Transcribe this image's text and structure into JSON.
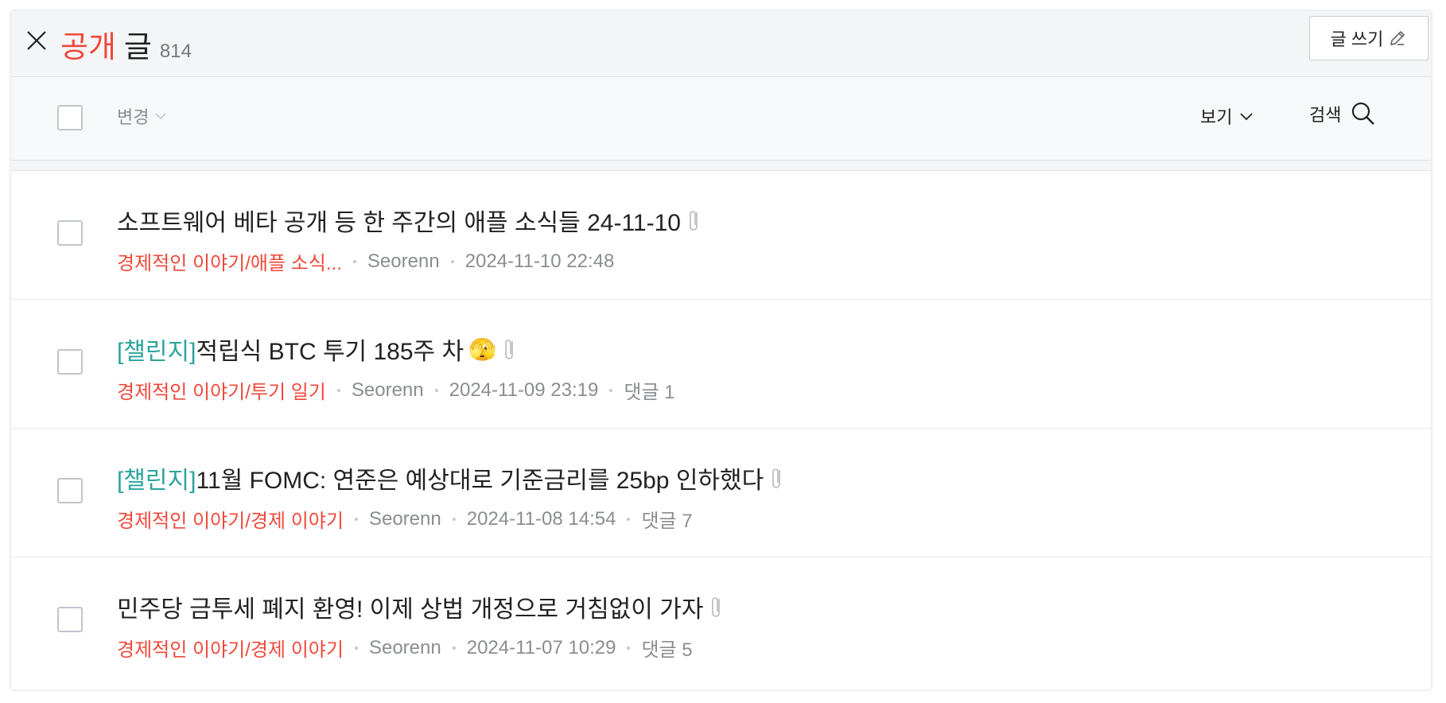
{
  "header": {
    "title_accent": "공개",
    "title_main": "글",
    "count": "814",
    "write_label": "글 쓰기"
  },
  "toolbar": {
    "change_label": "변경",
    "view_label": "보기",
    "search_label": "검색"
  },
  "posts": [
    {
      "prefix": "",
      "title": "소프트웨어 베타 공개 등 한 주간의 애플 소식들 24-11-10",
      "emoji": "",
      "category": "경제적인 이야기/애플 소식...",
      "author": "Seorenn",
      "datetime": "2024-11-10 22:48",
      "comments": ""
    },
    {
      "prefix": "[챌린지]",
      "title": "적립식 BTC 투기 185주 차",
      "emoji": "🫣",
      "category": "경제적인 이야기/투기 일기",
      "author": "Seorenn",
      "datetime": "2024-11-09 23:19",
      "comments": "댓글 1"
    },
    {
      "prefix": "[챌린지]",
      "title": "11월 FOMC: 연준은 예상대로 기준금리를 25bp 인하했다",
      "emoji": "",
      "category": "경제적인 이야기/경제 이야기",
      "author": "Seorenn",
      "datetime": "2024-11-08 14:54",
      "comments": "댓글 7"
    },
    {
      "prefix": "",
      "title": "민주당 금투세 폐지 환영! 이제 상법 개정으로 거침없이 가자",
      "emoji": "",
      "category": "경제적인 이야기/경제 이야기",
      "author": "Seorenn",
      "datetime": "2024-11-07 10:29",
      "comments": "댓글 5"
    }
  ],
  "colors": {
    "accent": "#f0483a",
    "prefix": "#2ba49c",
    "muted": "#8a8d92"
  }
}
